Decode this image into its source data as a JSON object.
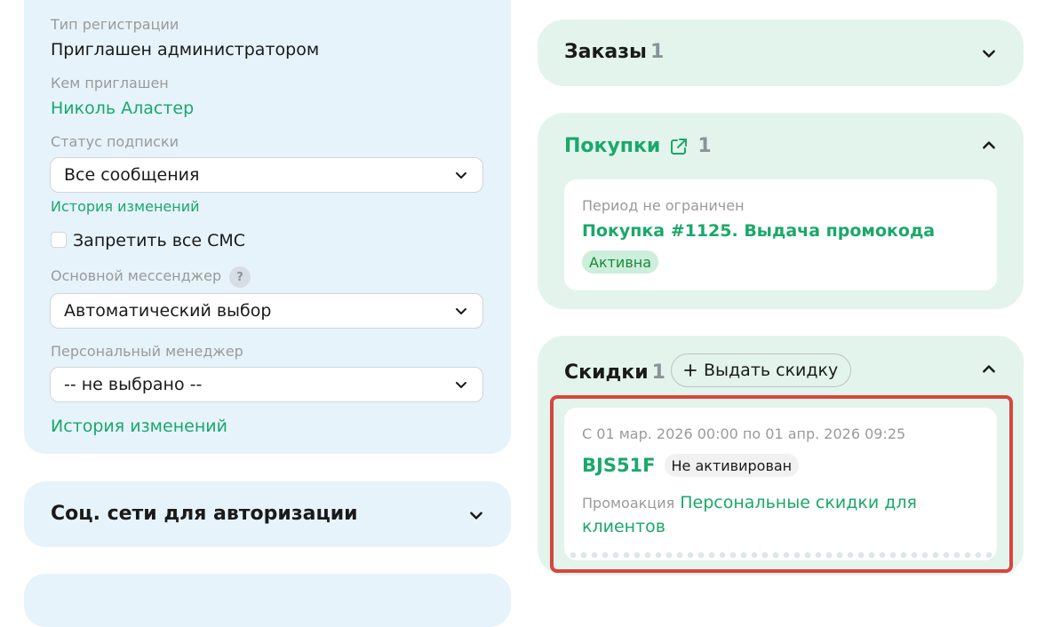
{
  "profile": {
    "reg_type_label": "Тип регистрации",
    "reg_type_value": "Приглашен администратором",
    "invited_by_label": "Кем приглашен",
    "invited_by_value": "Николь Аластер",
    "subscription_label": "Статус подписки",
    "subscription_value": "Все сообщения",
    "history_link_1": "История изменений",
    "ban_sms_label": "Запретить все СМС",
    "ban_sms_checked": false,
    "messenger_label": "Основной мессенджер",
    "messenger_help": "?",
    "messenger_value": "Автоматический выбор",
    "manager_label": "Персональный менеджер",
    "manager_value": "-- не выбрано --",
    "history_link_2": "История изменений"
  },
  "social": {
    "title": "Соц. сети для авторизации"
  },
  "orders": {
    "title": "Заказы",
    "count": "1"
  },
  "purchases": {
    "title": "Покупки",
    "count": "1",
    "item": {
      "period": "Период не ограничен",
      "name": "Покупка #1125. Выдача промокода",
      "status": "Активна"
    }
  },
  "discounts": {
    "title": "Скидки",
    "count": "1",
    "add_button": "Выдать скидку",
    "item": {
      "period": "С 01 мар. 2026 00:00 по 01 апр. 2026 09:25",
      "code": "BJS51F",
      "status": "Не активирован",
      "promo_label": "Промоакция",
      "promo_line1": "Персональные скидки для",
      "promo_line2": "клиентов"
    }
  },
  "colors": {
    "accent": "#1aa86b",
    "left_card_bg": "#e6f3fb",
    "right_card_bg": "#e3f4ec",
    "highlight": "#d9453d"
  }
}
